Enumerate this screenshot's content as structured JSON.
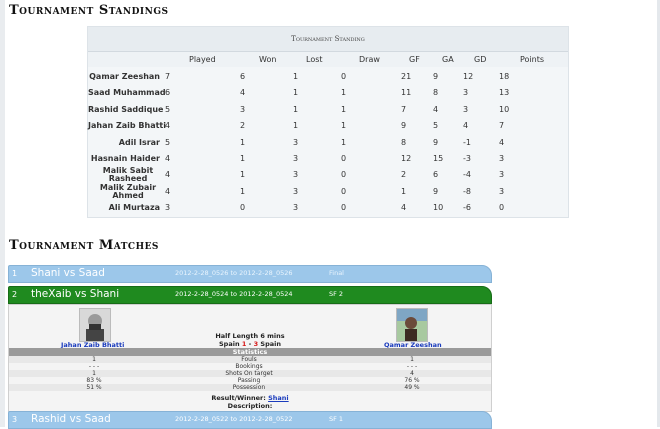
{
  "page": {
    "section_standings": "Tournament Standings",
    "section_matches": "Tournament Matches"
  },
  "standings": {
    "caption": "Tournament Standing",
    "columns": [
      "Played",
      "Won",
      "Lost",
      "Draw",
      "GF",
      "GA",
      "GD",
      "Points"
    ],
    "rows": [
      {
        "name": "Qamar Zeeshan",
        "played": "7",
        "won": "6",
        "lost": "1",
        "draw": "0",
        "gf": "21",
        "ga": "9",
        "gd": "12",
        "points": "18"
      },
      {
        "name": "Saad Muhammad",
        "played": "6",
        "won": "4",
        "lost": "1",
        "draw": "1",
        "gf": "11",
        "ga": "8",
        "gd": "3",
        "points": "13"
      },
      {
        "name": "Rashid Saddique",
        "played": "5",
        "won": "3",
        "lost": "1",
        "draw": "1",
        "gf": "7",
        "ga": "4",
        "gd": "3",
        "points": "10"
      },
      {
        "name": "Jahan Zaib Bhatti",
        "played": "4",
        "won": "2",
        "lost": "1",
        "draw": "1",
        "gf": "9",
        "ga": "5",
        "gd": "4",
        "points": "7"
      },
      {
        "name": "Adil Israr",
        "played": "5",
        "won": "1",
        "lost": "3",
        "draw": "1",
        "gf": "8",
        "ga": "9",
        "gd": "-1",
        "points": "4"
      },
      {
        "name": "Hasnain Haider",
        "played": "4",
        "won": "1",
        "lost": "3",
        "draw": "0",
        "gf": "12",
        "ga": "15",
        "gd": "-3",
        "points": "3"
      },
      {
        "name": "Malik Sabit Rasheed",
        "played": "4",
        "won": "1",
        "lost": "3",
        "draw": "0",
        "gf": "2",
        "ga": "6",
        "gd": "-4",
        "points": "3"
      },
      {
        "name": "Malik Zubair Ahmed",
        "played": "4",
        "won": "1",
        "lost": "3",
        "draw": "0",
        "gf": "1",
        "ga": "9",
        "gd": "-8",
        "points": "3"
      },
      {
        "name": "Ali Murtaza",
        "played": "3",
        "won": "0",
        "lost": "3",
        "draw": "0",
        "gf": "4",
        "ga": "10",
        "gd": "-6",
        "points": "0"
      }
    ]
  },
  "matches": [
    {
      "num": "1",
      "title": "Shani vs Saad",
      "when": "2012-2-28_0526 to 2012-2-28_0526",
      "stage": "Final"
    },
    {
      "num": "2",
      "title": "theXaib vs Shani",
      "when": "2012-2-28_0524 to 2012-2-28_0524",
      "stage": "SF 2"
    },
    {
      "num": "3",
      "title": "Rashid vs Saad",
      "when": "2012-2-28_0522 to 2012-2-28_0522",
      "stage": "SF 1"
    }
  ],
  "match_detail": {
    "player_left": "Jahan Zaib Bhatti",
    "player_right": "Qamar Zeeshan",
    "half_length": "Half Length 6 mins",
    "score_left_name": "Spain",
    "score_left": "1",
    "score_sep": "-",
    "score_right": "3",
    "score_right_name": "Spain",
    "stats_header": "Statistics",
    "stats": [
      {
        "label": "Fouls",
        "left": "1",
        "right": "1"
      },
      {
        "label": "Bookings",
        "left": "- - -",
        "right": "- - -"
      },
      {
        "label": "Shots On target",
        "left": "1",
        "right": "4"
      },
      {
        "label": "Passing",
        "left": "83 %",
        "right": "76 %"
      },
      {
        "label": "Possession",
        "left": "51 %",
        "right": "49 %"
      }
    ],
    "result_label": "Result/Winner:",
    "result_value": "Shani",
    "description_label": "Description:"
  }
}
